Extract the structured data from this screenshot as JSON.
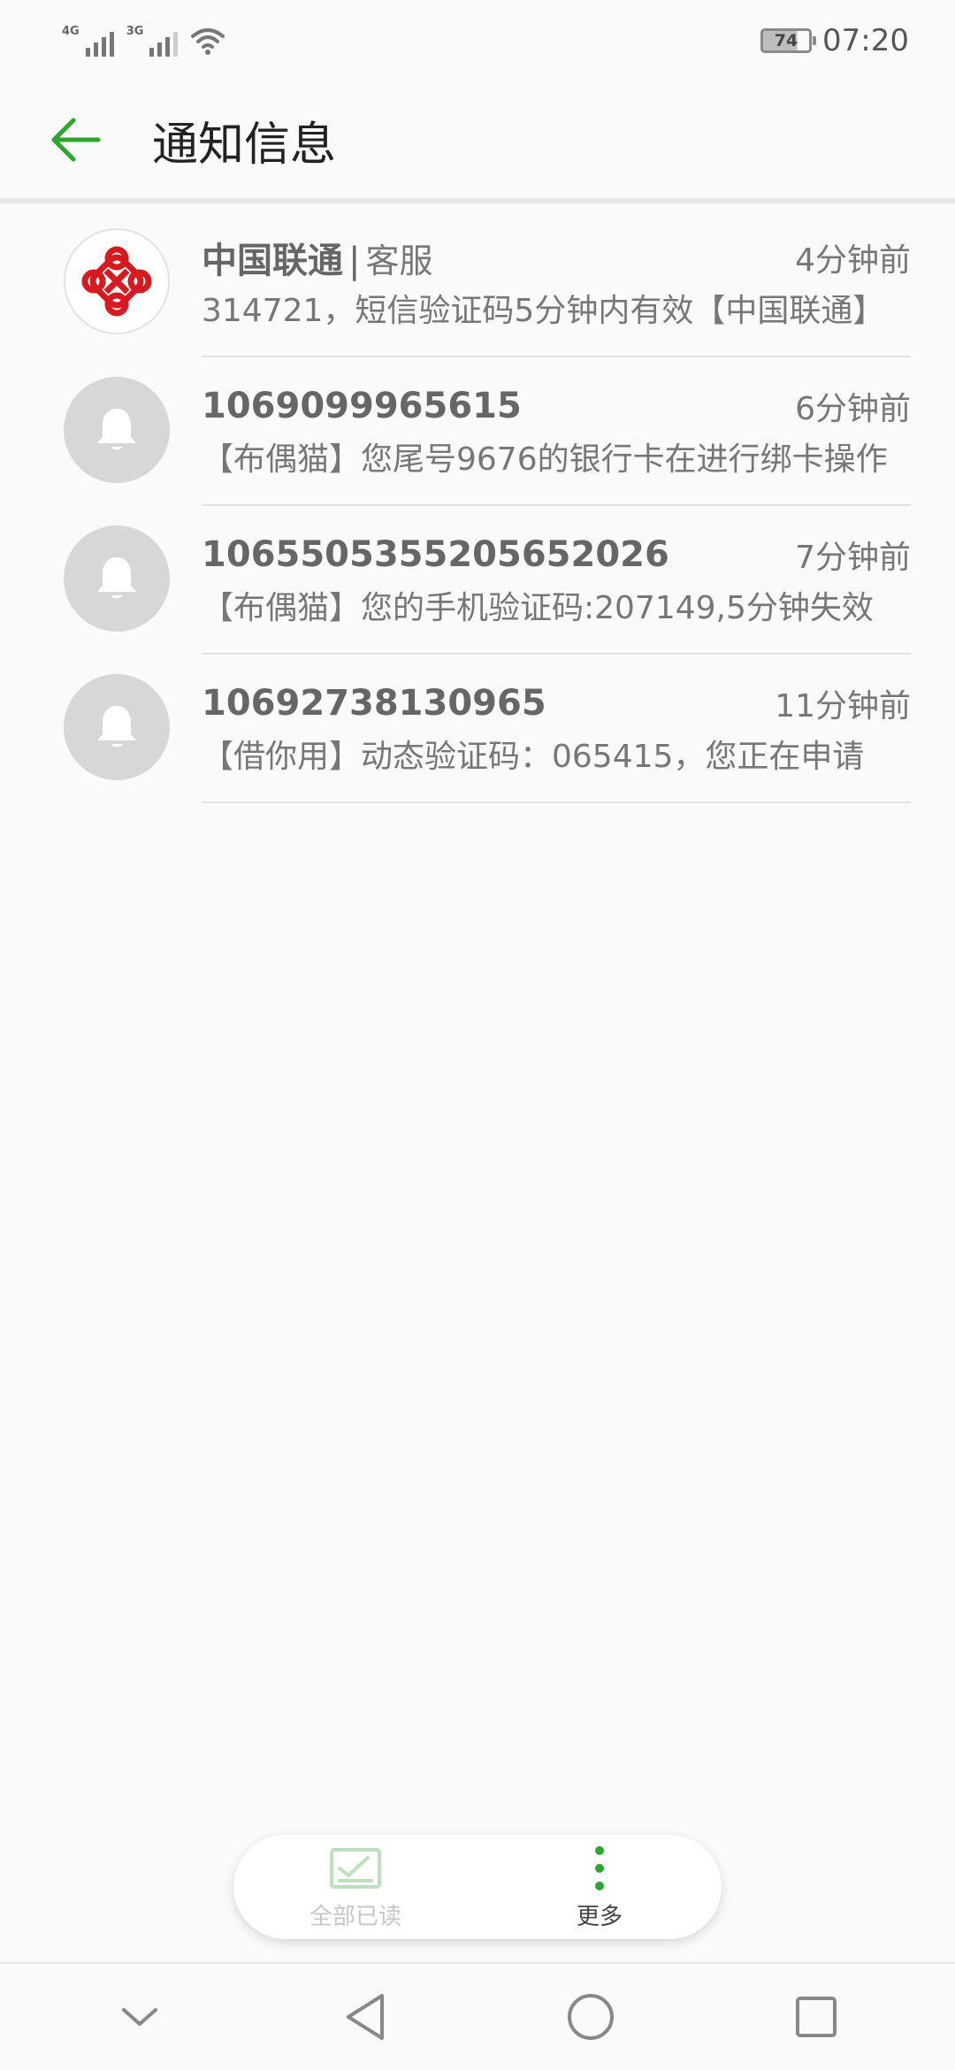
{
  "status_bar": {
    "network_1": "4G",
    "network_2": "3G",
    "battery_level": "74",
    "time": "07:20"
  },
  "header": {
    "title": "通知信息",
    "accent_color": "#2ea52e"
  },
  "messages": [
    {
      "sender": "中国联通",
      "sender_sub": "客服",
      "time": "4分钟前",
      "preview": "314721，短信验证码5分钟内有效【中国联通】",
      "avatar": "china-unicom-logo"
    },
    {
      "sender": "1069099965615",
      "time": "6分钟前",
      "preview": "【布偶猫】您尾号9676的银行卡在进行绑卡操作",
      "avatar": "bell-icon"
    },
    {
      "sender": "1065505355205652026",
      "time": "7分钟前",
      "preview": "【布偶猫】您的手机验证码:207149,5分钟失效",
      "avatar": "bell-icon"
    },
    {
      "sender": "10692738130965",
      "time": "11分钟前",
      "preview": "【借你用】动态验证码：065415，您正在申请",
      "avatar": "bell-icon"
    }
  ],
  "actions": {
    "mark_all_read": "全部已读",
    "more": "更多"
  }
}
